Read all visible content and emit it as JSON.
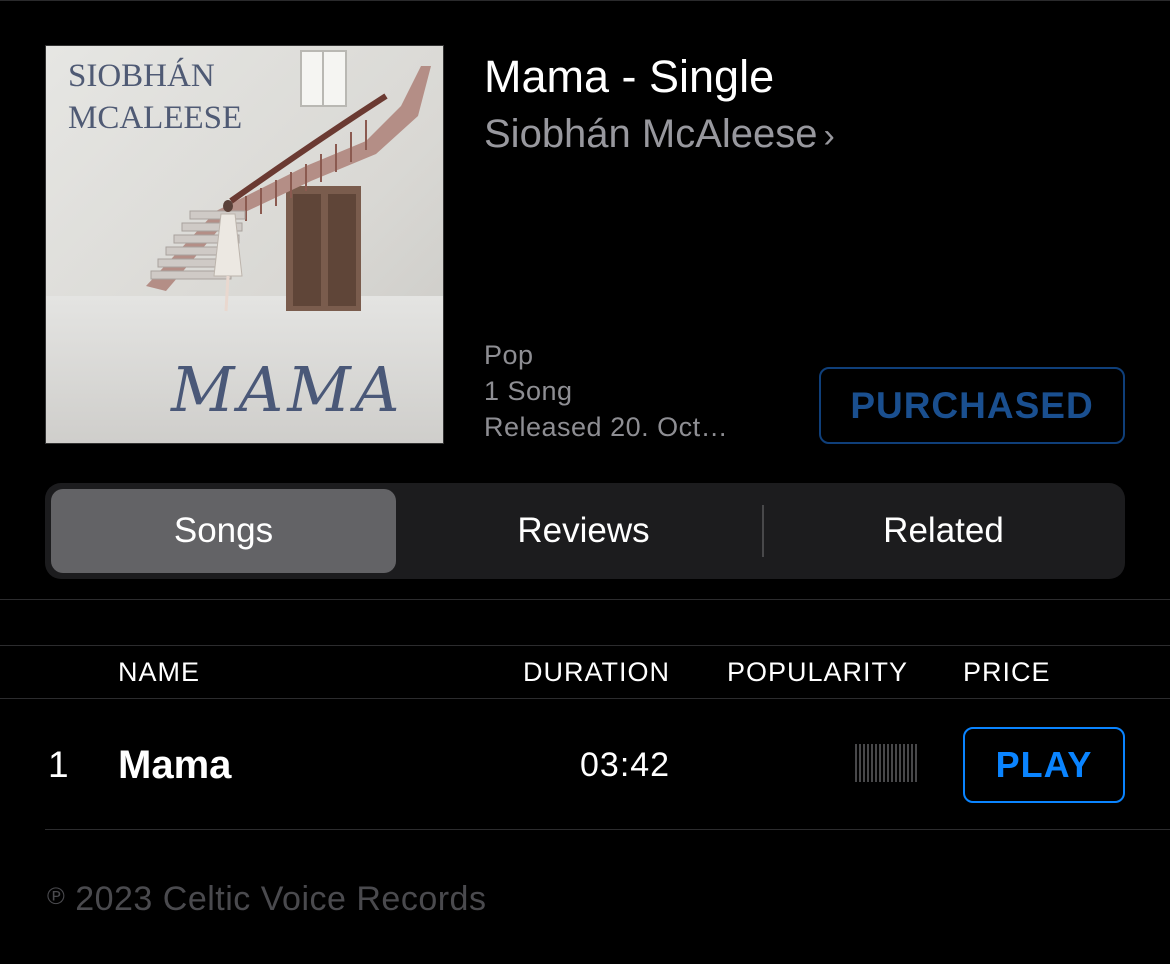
{
  "album": {
    "title": "Mama - Single",
    "artist": "Siobhán McAleese",
    "genre": "Pop",
    "song_count": "1 Song",
    "released": "Released 20. Oct…",
    "purchase_status": "PURCHASED",
    "artwork": {
      "artist_line_1": "SIOBHÁN",
      "artist_line_2": "MCALEESE",
      "title_script": "MAMA"
    }
  },
  "icons": {
    "artist_chevron": "chevron-right-icon",
    "phonogram": "phonogram-p-icon"
  },
  "tabs": [
    {
      "label": "Songs",
      "selected": true
    },
    {
      "label": "Reviews",
      "selected": false
    },
    {
      "label": "Related",
      "selected": false
    }
  ],
  "table": {
    "headers": {
      "name": "NAME",
      "duration": "DURATION",
      "popularity": "POPULARITY",
      "price": "PRICE"
    },
    "rows": [
      {
        "number": "1",
        "name": "Mama",
        "duration": "03:42",
        "popularity": 0,
        "action": "PLAY"
      }
    ]
  },
  "footer": {
    "phonogram_symbol": "℗",
    "copyright": "2023 Celtic Voice Records"
  },
  "colors": {
    "background": "#000000",
    "accent": "#0a84ff",
    "secondary_text": "#8e8e93",
    "purchased": "#1a4f8f"
  }
}
